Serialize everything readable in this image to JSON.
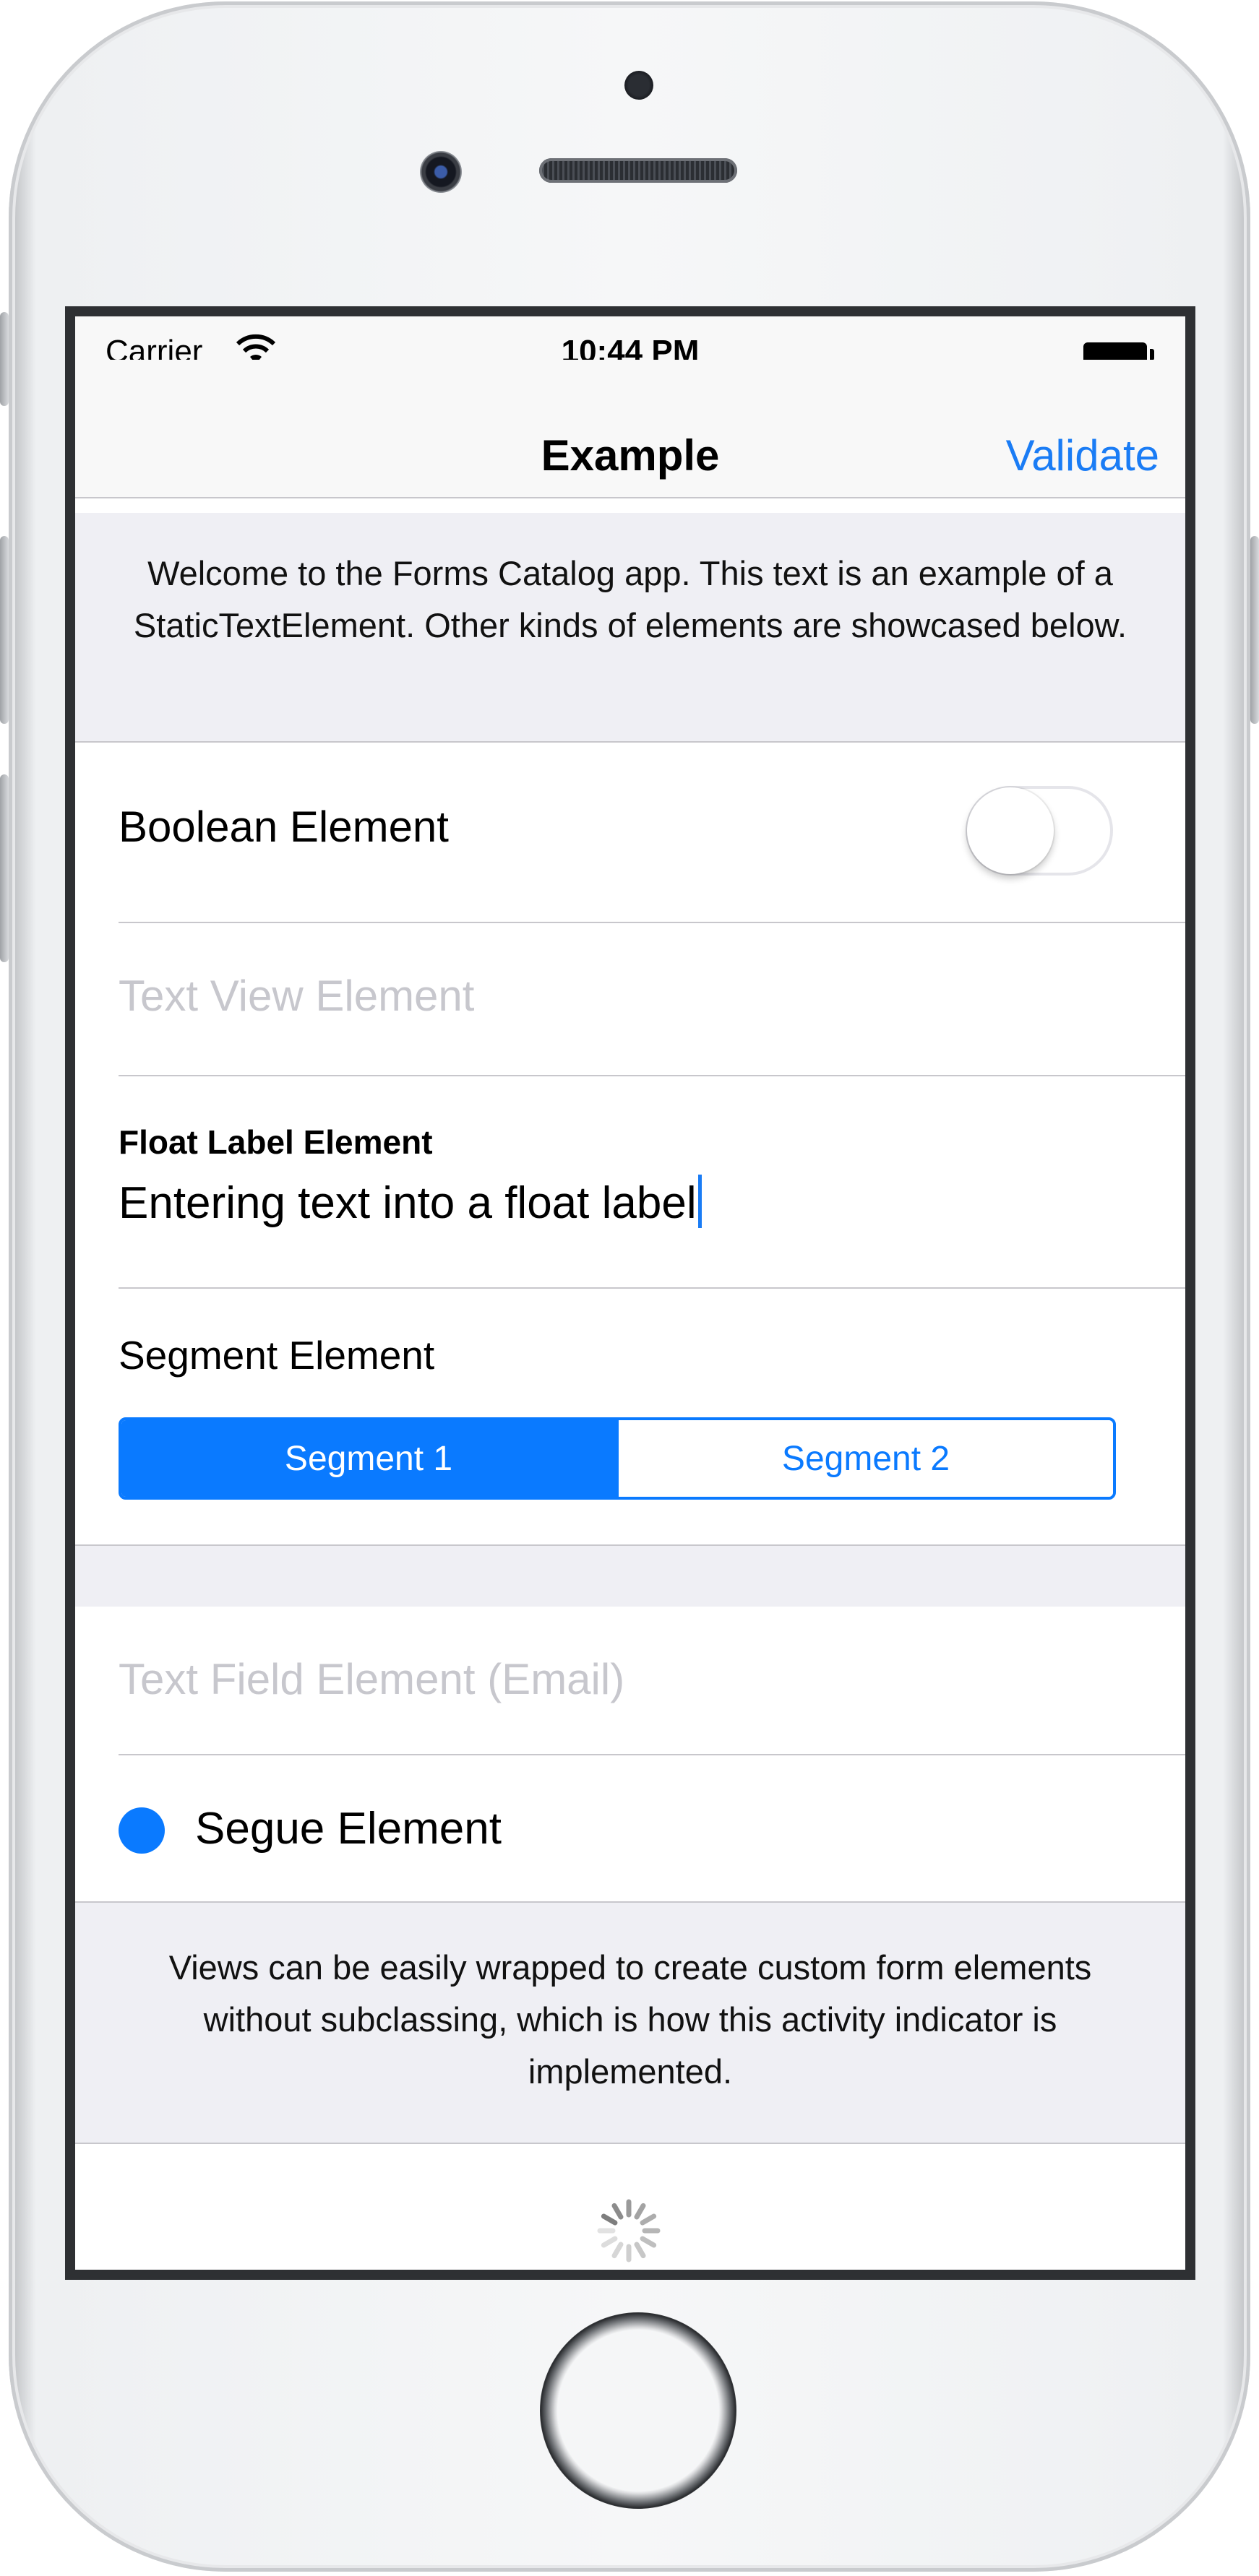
{
  "status_bar": {
    "carrier": "Carrier",
    "time": "10:44 PM",
    "wifi_icon": "wifi-icon",
    "battery_icon": "battery-full-icon"
  },
  "nav": {
    "title": "Example",
    "validate_label": "Validate"
  },
  "static_text": "Welcome to the Forms Catalog app. This text is an example of a StaticTextElement. Other kinds of elements are showcased below.",
  "boolean_element": {
    "label": "Boolean Element",
    "on": false
  },
  "text_view_element": {
    "placeholder": "Text View Element"
  },
  "float_label_element": {
    "label": "Float Label Element",
    "value": "Entering text into a float label"
  },
  "segment_element": {
    "label": "Segment Element",
    "segments": [
      "Segment 1",
      "Segment 2"
    ],
    "selected_index": 0
  },
  "text_field_element": {
    "placeholder": "Text Field Element (Email)"
  },
  "segue_element": {
    "label": "Segue Element"
  },
  "info_text": "Views can be easily wrapped to create custom form elements without subclassing, which is how this activity indicator is implemented.",
  "activity_indicator_icon": "spinner-icon",
  "colors": {
    "accent": "#0a7aff",
    "group_background": "#efeff4",
    "separator": "#c8c7cc",
    "placeholder": "#c7c7cd"
  }
}
